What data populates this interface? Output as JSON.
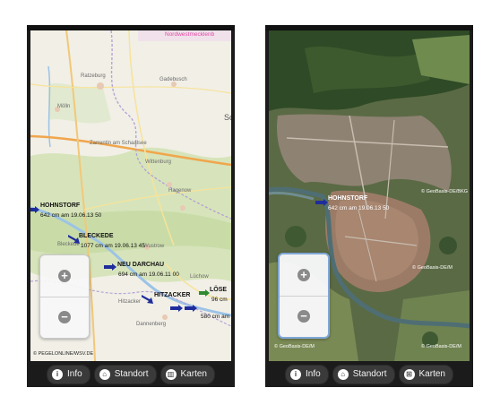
{
  "left_screen": {
    "map_labels": {
      "region": "Nordwestmecklenb",
      "places": [
        "Ratzeburg",
        "Gadebusch",
        "Mölln",
        "Sc",
        "Zarrentin am Schaalsee",
        "Wittenburg",
        "Hagenow",
        "Bleckede",
        "Wustrow",
        "Dannenberg",
        "Hitzacker",
        "Lüchow"
      ],
      "copyright": "© PEGELONLINE/WSV.DE"
    },
    "stations": [
      {
        "name": "HOHNSTORF",
        "reading": "642 cm am 19.06.13 50"
      },
      {
        "name": "BLECKEDE",
        "reading": "1077 cm am 19.06.13 45"
      },
      {
        "name": "NEU DARCHAU",
        "reading": "694 cm am 19.06.11 00"
      },
      {
        "name": "HITZACKER",
        "reading": ""
      },
      {
        "name": "LÖSE",
        "reading": "96 cm"
      },
      {
        "name": "",
        "reading": "580 cm am"
      }
    ],
    "zoom": {
      "plus": "+",
      "minus": "−"
    },
    "tabs": [
      {
        "label": "Info",
        "icon": "info-icon",
        "glyph": "i"
      },
      {
        "label": "Standort",
        "icon": "home-icon",
        "glyph": "⌂"
      },
      {
        "label": "Karten",
        "icon": "map-grid-icon",
        "glyph": "▥"
      }
    ]
  },
  "right_screen": {
    "station": {
      "name": "HOHNSTORF",
      "reading": "642 cm am 19.06.13 50"
    },
    "copyright_left": "© GeoBasis-DE/BKG",
    "copyright_mid": "© GeoBasis-DE/M",
    "copyright_mid2": "© GeoBasis-DE/M",
    "copyright_bottom_left": "© GeoBasis-DE/M",
    "zoom": {
      "plus": "+",
      "minus": "−"
    },
    "tabs": [
      {
        "label": "Info",
        "icon": "info-icon",
        "glyph": "i"
      },
      {
        "label": "Standort",
        "icon": "home-icon",
        "glyph": "⌂"
      },
      {
        "label": "Karten",
        "icon": "map-grid-icon",
        "glyph": "⊞"
      }
    ]
  },
  "colors": {
    "arrow": "#1f2d9c",
    "arrow_green": "#2f8a2f",
    "tabbar": "#1b1b1b"
  }
}
